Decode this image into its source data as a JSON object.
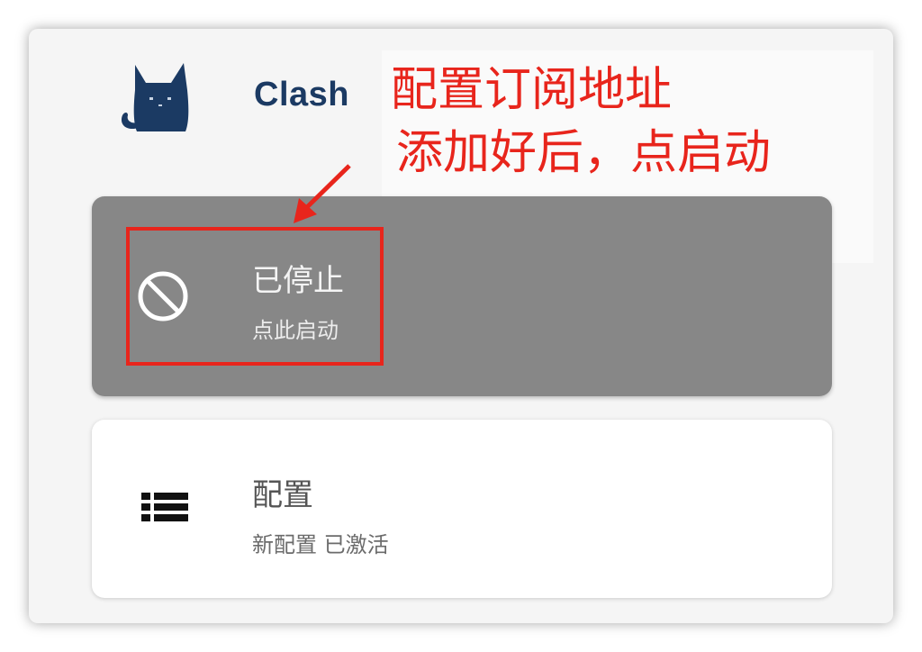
{
  "app": {
    "title": "Clash"
  },
  "annotation": {
    "line1": "配置订阅地址",
    "line2": "添加好后，点启动",
    "color": "#e8251c"
  },
  "status_card": {
    "title": "已停止",
    "subtitle": "点此启动",
    "icon": "blocked-icon",
    "background": "#878787"
  },
  "config_card": {
    "title": "配置",
    "subtitle": "新配置 已激活",
    "icon": "list-icon"
  }
}
